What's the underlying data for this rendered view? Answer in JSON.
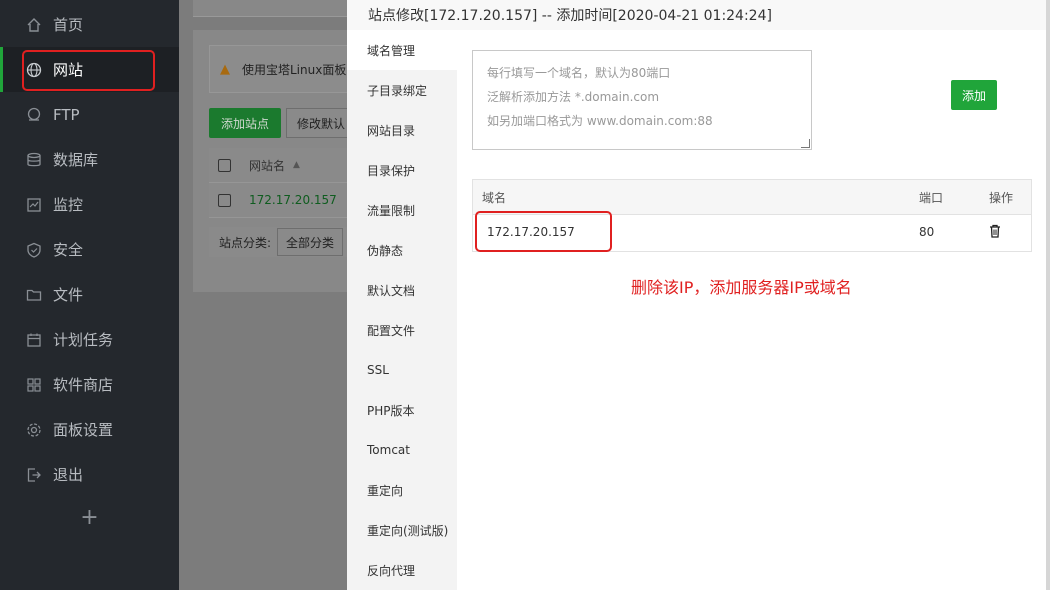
{
  "sidebar": {
    "items": [
      {
        "label": "首页",
        "icon": "home-icon"
      },
      {
        "label": "网站",
        "icon": "globe-icon"
      },
      {
        "label": "FTP",
        "icon": "ftp-icon"
      },
      {
        "label": "数据库",
        "icon": "database-icon"
      },
      {
        "label": "监控",
        "icon": "monitor-icon"
      },
      {
        "label": "安全",
        "icon": "shield-icon"
      },
      {
        "label": "文件",
        "icon": "folder-icon"
      },
      {
        "label": "计划任务",
        "icon": "calendar-icon"
      },
      {
        "label": "软件商店",
        "icon": "apps-icon"
      },
      {
        "label": "面板设置",
        "icon": "gear-icon"
      },
      {
        "label": "退出",
        "icon": "logout-icon"
      }
    ],
    "active": "网站",
    "add_label": "+"
  },
  "background": {
    "warning_text": "使用宝塔Linux面板",
    "add_site_label": "添加站点",
    "modify_label": "修改默认",
    "col_site_name": "网站名",
    "site_row": "172.17.20.157",
    "category_label": "站点分类:",
    "category_value": "全部分类"
  },
  "modal": {
    "title": "站点修改[172.17.20.157] -- 添加时间[2020-04-21 01:24:24]",
    "tabs": [
      "域名管理",
      "子目录绑定",
      "网站目录",
      "目录保护",
      "流量限制",
      "伪静态",
      "默认文档",
      "配置文件",
      "SSL",
      "PHP版本",
      "Tomcat",
      "重定向",
      "重定向(测试版)",
      "反向代理"
    ],
    "active_tab": "域名管理",
    "textarea_lines": [
      "每行填写一个域名，默认为80端口",
      "泛解析添加方法 *.domain.com",
      "如另加端口格式为 www.domain.com:88"
    ],
    "add_button": "添加",
    "table": {
      "headers": {
        "domain": "域名",
        "port": "端口",
        "action": "操作"
      },
      "rows": [
        {
          "domain": "172.17.20.157",
          "port": "80"
        }
      ]
    },
    "annotation": "删除该IP，添加服务器IP或域名"
  },
  "colors": {
    "accent": "#20a53a",
    "annotation": "#e02020",
    "sidebar_bg": "#24282d"
  }
}
